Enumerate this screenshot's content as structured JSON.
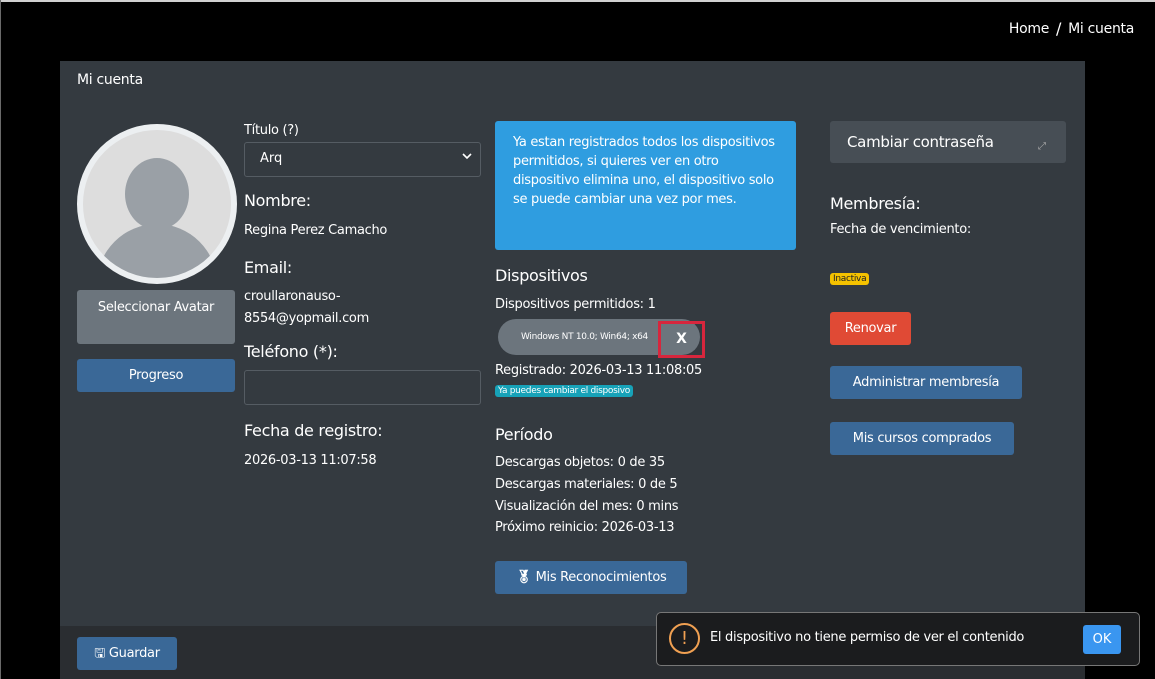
{
  "breadcrumb": {
    "home": "Home",
    "separator": "/",
    "current": "Mi cuenta"
  },
  "card": {
    "title": "Mi cuenta"
  },
  "left": {
    "select_avatar_label": "Seleccionar Avatar",
    "progress_label": "Progreso"
  },
  "profile": {
    "title_label": "Título (?)",
    "title_value": "Arq",
    "name_label": "Nombre:",
    "name_value": "Regina Perez Camacho",
    "email_label": "Email:",
    "email_value_line1": "croullaronauso-",
    "email_value_line2": "8554@yopmail.com",
    "phone_label": "Teléfono (*):",
    "phone_value": "",
    "reg_label": "Fecha de registro:",
    "reg_value": "2026-03-13 11:07:58"
  },
  "devices": {
    "alert": "Ya estan registrados todos los dispositivos permitidos, si quieres ver en otro dispositivo elimina uno, el dispositivo solo se puede cambiar una vez por mes.",
    "heading": "Dispositivos",
    "allowed": "Dispositivos permitidos: 1",
    "device_name": "Windows NT 10.0; Win64; x64",
    "remove": "X",
    "registered": "Registrado: 2026-03-13 11:08:05",
    "change_badge": "Ya puedes cambiar el disposivo"
  },
  "period": {
    "heading": "Período",
    "downloads_objects": "Descargas objetos: 0 de 35",
    "downloads_materials": "Descargas materiales: 0 de 5",
    "views": "Visualización del mes: 0 mins",
    "next_reset": "Próximo reinicio: 2026-03-13",
    "recognitions_label": "Mis Reconocimientos"
  },
  "membership": {
    "change_password": "Cambiar contraseña",
    "heading": "Membresía:",
    "expiry_label": "Fecha de vencimiento:",
    "status_badge": "Inactiva",
    "renew": "Renovar",
    "manage": "Administrar membresía",
    "courses": "Mis cursos comprados"
  },
  "footer": {
    "save_label": "Guardar"
  },
  "toast": {
    "icon": "!",
    "message": "El dispositivo no tiene permiso de ver el contenido",
    "ok": "OK"
  },
  "colors": {
    "card": "#343a40",
    "alert": "#2f9de0",
    "primary": "#3a6897",
    "danger": "#e04a35",
    "warning": "#f5c200",
    "info": "#17a2b8"
  },
  "icons": {
    "remove": "close-icon",
    "pwd": "arrows-icon",
    "medal": "medal-icon",
    "save": "floppy-icon",
    "alert": "exclamation-icon",
    "select": "chevron-down-icon"
  }
}
